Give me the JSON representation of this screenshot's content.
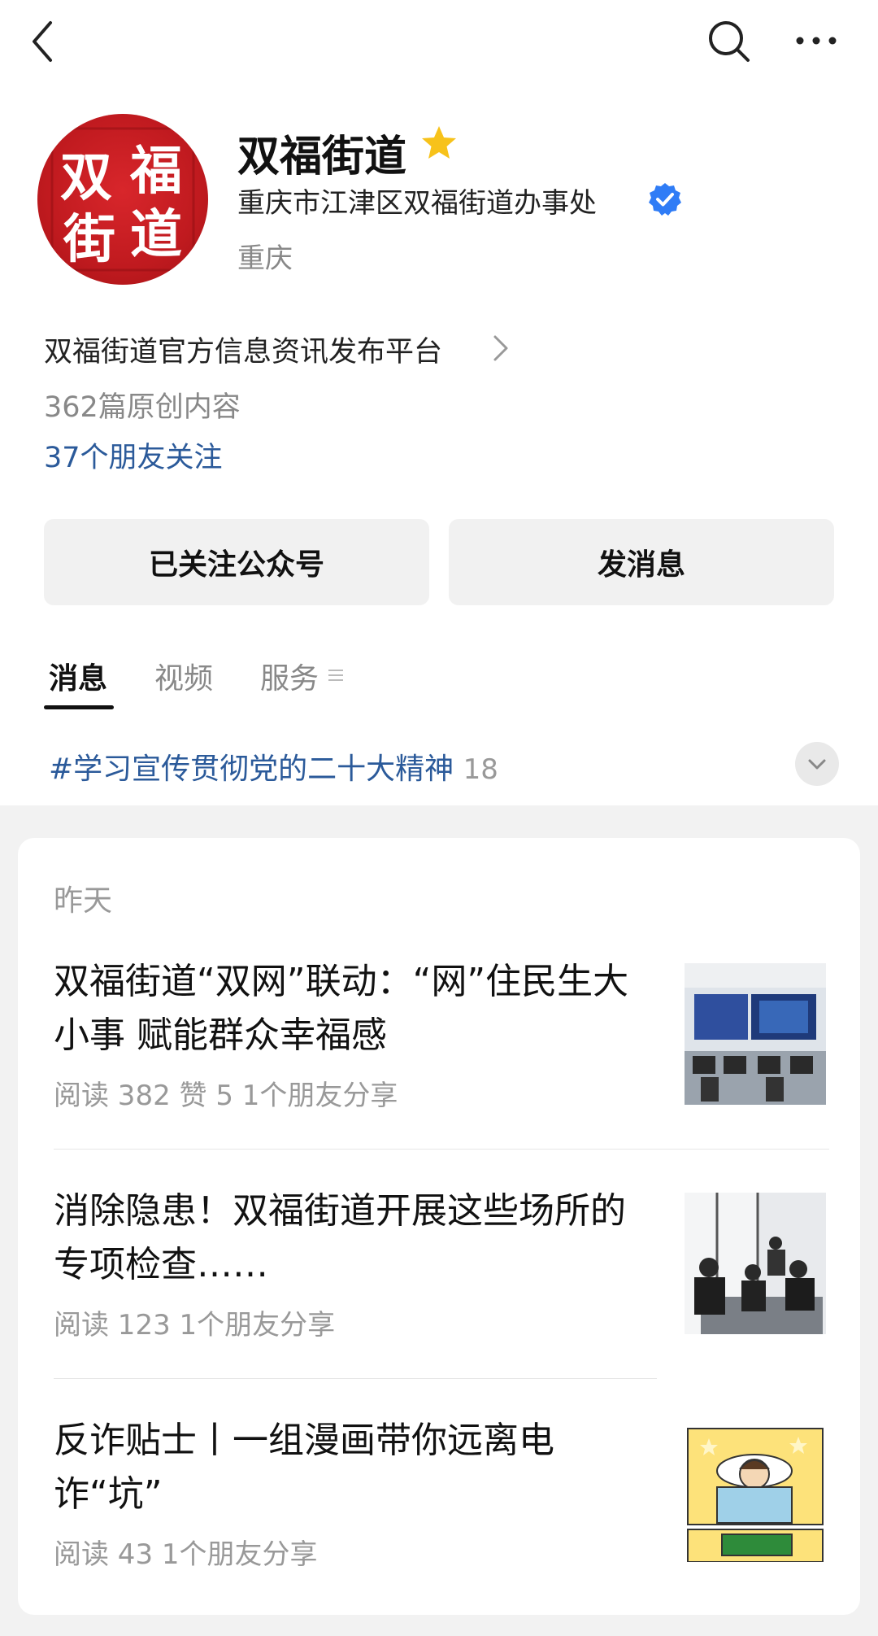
{
  "profile": {
    "name": "双福街道",
    "organization": "重庆市江津区双福街道办事处",
    "location": "重庆",
    "logo_chars": [
      "双",
      "福",
      "街",
      "道"
    ]
  },
  "intro": {
    "description": "双福街道官方信息资讯发布平台",
    "original_count": "362篇原创内容",
    "friends_follow": "37个朋友关注"
  },
  "actions": {
    "follow_label": "已关注公众号",
    "message_label": "发消息"
  },
  "tabs": [
    {
      "label": "消息"
    },
    {
      "label": "视频"
    },
    {
      "label": "服务"
    }
  ],
  "topic": {
    "label": "#学习宣传贯彻党的二十大精神",
    "count": "18"
  },
  "feed": {
    "date": "昨天",
    "articles": [
      {
        "title": "双福街道“双网”联动：“网”住民生大小事  赋能群众幸福感",
        "meta": "阅读 382   赞 5   1个朋友分享"
      },
      {
        "title": "消除隐患！双福街道开展这些场所的专项检查……",
        "meta": "阅读 123   1个朋友分享"
      },
      {
        "title": "反诈贴士丨一组漫画带你远离电诈“坑”",
        "meta": "阅读 43   1个朋友分享"
      }
    ]
  },
  "colors": {
    "link_blue": "#2b5a9a",
    "verified_blue": "#2f7cf6",
    "star_gold": "#f7c21a",
    "logo_red": "#c01a1f"
  },
  "icons": {
    "back": "back-arrow-icon",
    "search": "search-icon",
    "more": "more-dots-icon",
    "star": "star-icon",
    "verified": "verified-badge-icon",
    "chevron": "chevron-right-icon",
    "expand": "chevron-down-icon"
  }
}
